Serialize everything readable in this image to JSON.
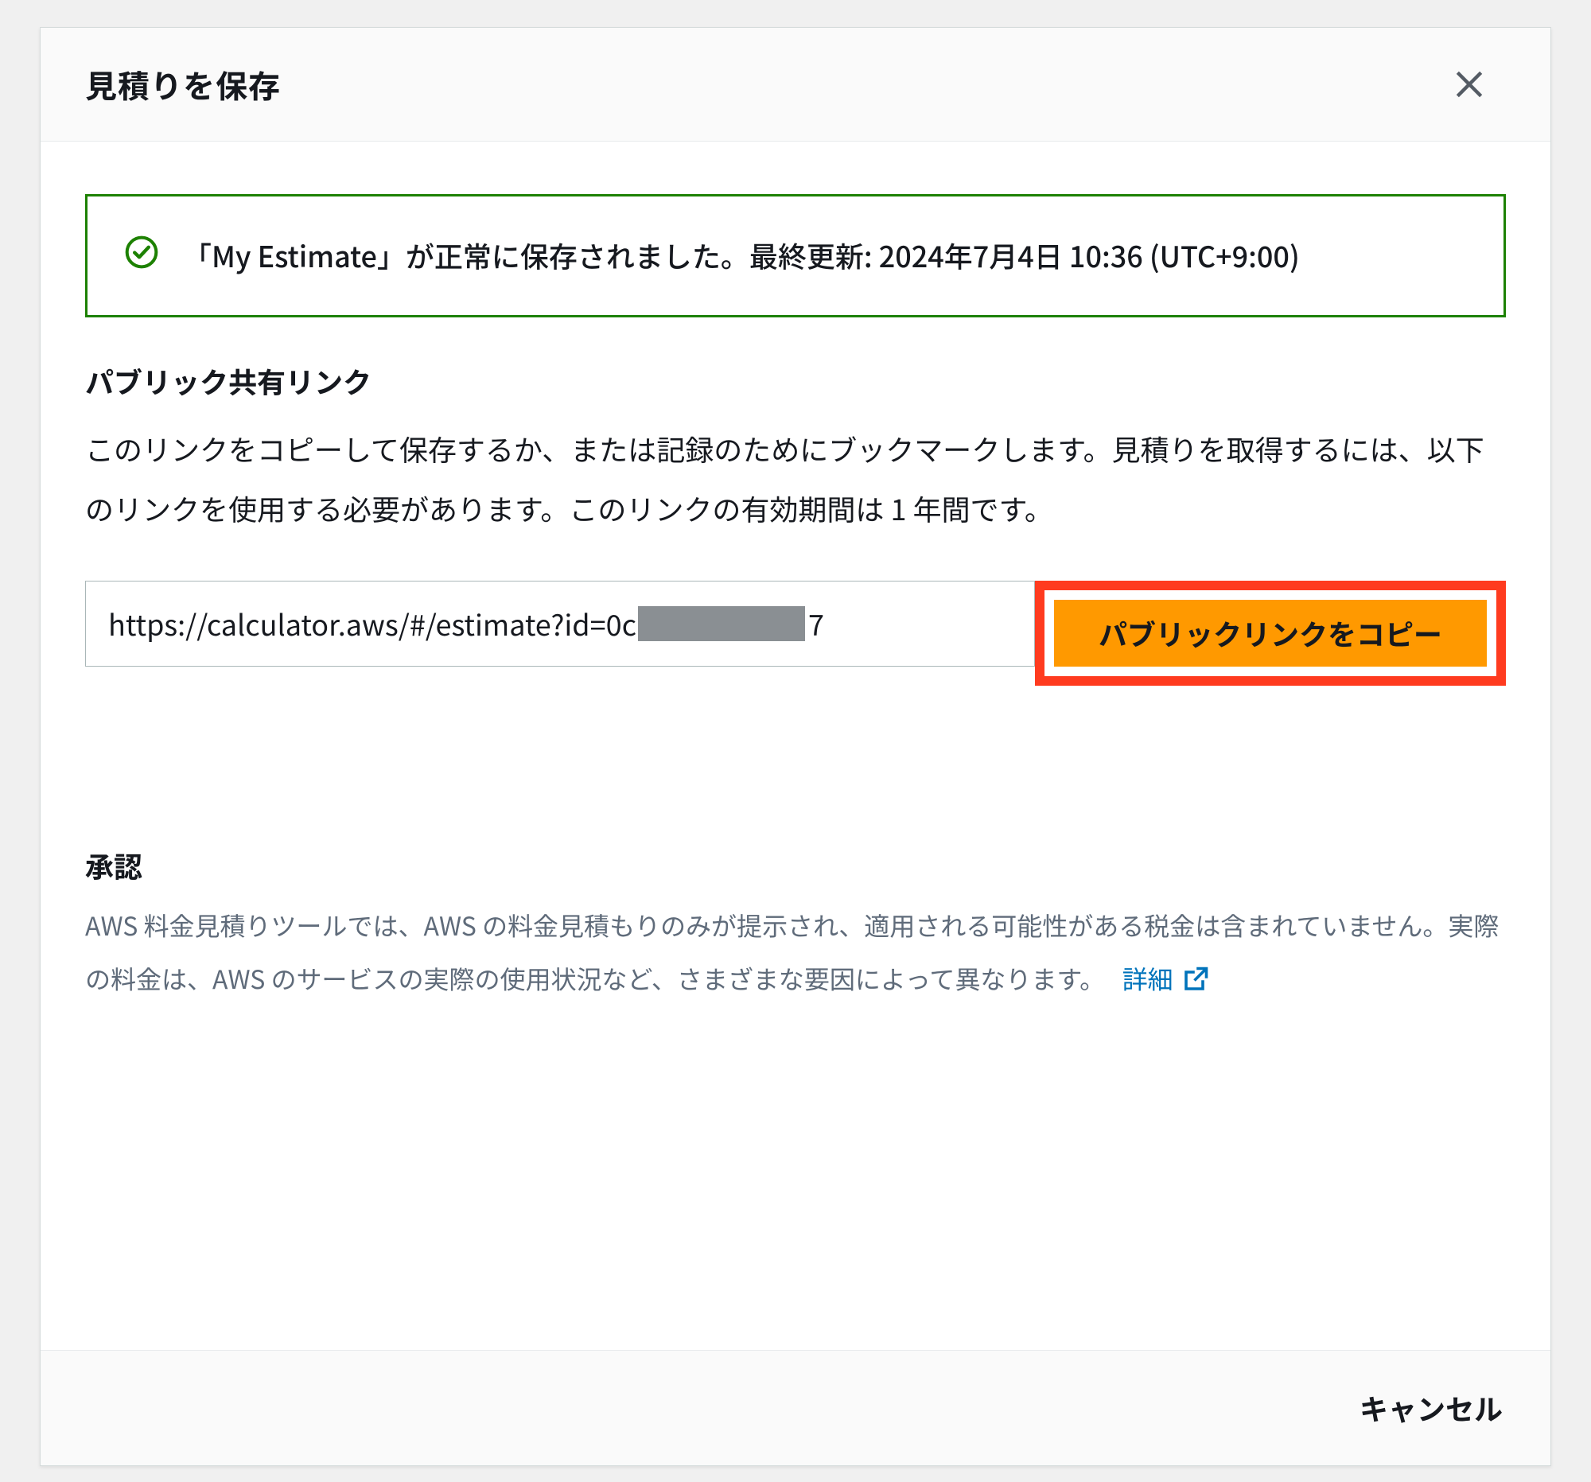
{
  "modal": {
    "title": "見積りを保存",
    "alert": {
      "message": "「My Estimate」が正常に保存されました。最終更新: 2024年7月4日 10:36 (UTC+9:00)"
    },
    "share": {
      "title": "パブリック共有リンク",
      "description": "このリンクをコピーして保存するか、または記録のためにブックマークします。見積りを取得するには、以下のリンクを使用する必要があります。このリンクの有効期間は 1 年間です。",
      "url_visible_prefix": "https://calculator.aws/#/estimate?id=0c",
      "url_visible_suffix": "7",
      "copy_button": "パブリックリンクをコピー"
    },
    "acknowledgment": {
      "title": "承認",
      "text": "AWS 料金見積りツールでは、AWS の料金見積もりのみが提示され、適用される可能性がある税金は含まれていません。実際の料金は、AWS のサービスの実際の使用状況など、さまざまな要因によって異なります。",
      "details_link": "詳細"
    },
    "footer": {
      "cancel": "キャンセル"
    }
  }
}
